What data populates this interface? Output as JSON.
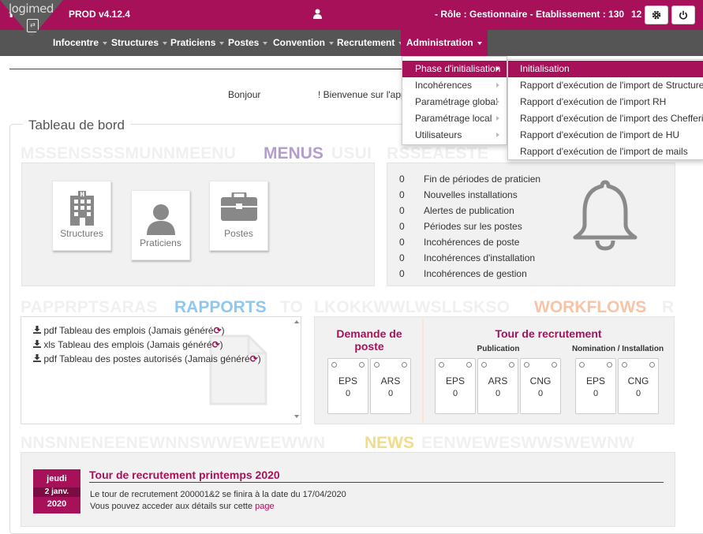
{
  "header": {
    "logo_text": "logimed",
    "version": "PROD v4.12.4",
    "role": "- Rôle : Gestionnaire - Etablissement : 130",
    "count": "12",
    "icons": [
      "user-icon",
      "gear-icon",
      "power-icon"
    ]
  },
  "nav": {
    "items": [
      {
        "label": "Infocentre"
      },
      {
        "label": "Structures"
      },
      {
        "label": "Praticiens"
      },
      {
        "label": "Postes"
      },
      {
        "label": "Convention"
      },
      {
        "label": "Recrutement"
      },
      {
        "label": "Administration"
      }
    ]
  },
  "admin_menu": {
    "items": [
      {
        "label": "Phase d'initialisation"
      },
      {
        "label": "Incohérences"
      },
      {
        "label": "Paramétrage global"
      },
      {
        "label": "Paramétrage local"
      },
      {
        "label": "Utilisateurs"
      }
    ],
    "submenu": [
      {
        "label": "Initialisation"
      },
      {
        "label": "Rapport d'exécution de l'import de Structures"
      },
      {
        "label": "Rapport d'exécution de l'import RH"
      },
      {
        "label": "Rapport d'exécution de l'import des Chefferies"
      },
      {
        "label": "Rapport d'exécution de l'import de HU"
      },
      {
        "label": "Rapport d'exécution de l'import de mails"
      }
    ]
  },
  "greeting": {
    "hello": "Bonjour",
    "welcome": "! Bienvenue sur l'appl"
  },
  "dashboard": {
    "title": "Tableau de bord",
    "menus": {
      "watermark": "MSSENSSSSMUNNMEENU",
      "watermark_right": "USUI",
      "title": "MENUS",
      "tiles": [
        {
          "label": "Structures",
          "icon": "building-icon"
        },
        {
          "label": "Praticiens",
          "icon": "user-icon"
        },
        {
          "label": "Postes",
          "icon": "briefcase-icon"
        }
      ]
    },
    "alerts": {
      "watermark": "RSSEAESTE",
      "items": [
        {
          "count": "0",
          "label": "Fin de périodes de praticien"
        },
        {
          "count": "0",
          "label": "Nouvelles installations"
        },
        {
          "count": "0",
          "label": "Alertes de publication"
        },
        {
          "count": "0",
          "label": "Périodes sur les postes"
        },
        {
          "count": "0",
          "label": "Incohérences de poste"
        },
        {
          "count": "0",
          "label": "Incohérences d'installation"
        },
        {
          "count": "0",
          "label": "Incohérences de gestion"
        }
      ]
    },
    "rapports": {
      "watermark": "PAPPRPTSARAS",
      "watermark_right": "TO",
      "title": "RAPPORTS",
      "items": [
        {
          "format": "pdf",
          "label": "Tableau des emplois (Jamais généré"
        },
        {
          "format": "xls",
          "label": "Tableau des emplois (Jamais généré"
        },
        {
          "format": "pdf",
          "label": "Tableau des postes autorisés (Jamais généré"
        }
      ],
      "close_paren": ")"
    },
    "workflows": {
      "watermark": "LKOKKWWLWSLLSKSO",
      "watermark_right": "R",
      "title": "WORKFLOWS",
      "demande_title": "Demande de poste",
      "tour_title": "Tour de recrutement",
      "publication_label": "Publication",
      "nomination_label": "Nomination / Installation",
      "demande_cards": [
        {
          "label": "EPS",
          "value": "0"
        },
        {
          "label": "ARS",
          "value": "0"
        }
      ],
      "publication_cards": [
        {
          "label": "EPS",
          "value": "0"
        },
        {
          "label": "ARS",
          "value": "0"
        },
        {
          "label": "CNG",
          "value": "0"
        }
      ],
      "nomination_cards": [
        {
          "label": "EPS",
          "value": "0"
        },
        {
          "label": "CNG",
          "value": "0"
        }
      ]
    },
    "news": {
      "watermark": "NNSNNENEENEWNNSWWEWEEWWN",
      "watermark_right": "EENWEWESWWSWEWNW",
      "title": "NEWS",
      "item": {
        "day": "jeudi",
        "date": "2 janv.",
        "year": "2020",
        "title": "Tour de recrutement printemps 2020",
        "line1": "Le tour de recrutement 200001&2 se finira à la date du 17/04/2020",
        "line2": "Vous pouvez acceder aux détails sur cette",
        "link": "page"
      }
    }
  },
  "colors": {
    "brand": "#a6115a",
    "nav": "#555555",
    "menus_accent": "#b39dcf",
    "rapports_accent": "#8ec8ee",
    "workflows_accent": "#f7c4a8",
    "news_accent": "#f2dc8a"
  }
}
